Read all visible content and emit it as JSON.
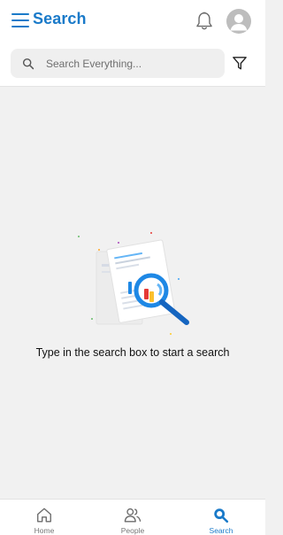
{
  "header": {
    "title": "Search",
    "menu_icon": "hamburger-menu-icon",
    "notification_icon": "bell-icon",
    "avatar_icon": "user-avatar-icon"
  },
  "search": {
    "placeholder": "Search Everything...",
    "value": "",
    "search_icon": "magnifier-icon",
    "filter_icon": "filter-funnel-icon"
  },
  "empty_state": {
    "message": "Type in the search box to start a search",
    "illustration": "document-magnifier-illustration"
  },
  "bottom_nav": {
    "items": [
      {
        "label": "Home",
        "icon": "home-icon",
        "active": false
      },
      {
        "label": "People",
        "icon": "people-icon",
        "active": false
      },
      {
        "label": "Search",
        "icon": "search-icon",
        "active": true
      }
    ]
  },
  "colors": {
    "accent": "#1a7ac9",
    "background": "#f1f1f1",
    "header_background": "#ffffff",
    "inactive_text": "#777777"
  }
}
